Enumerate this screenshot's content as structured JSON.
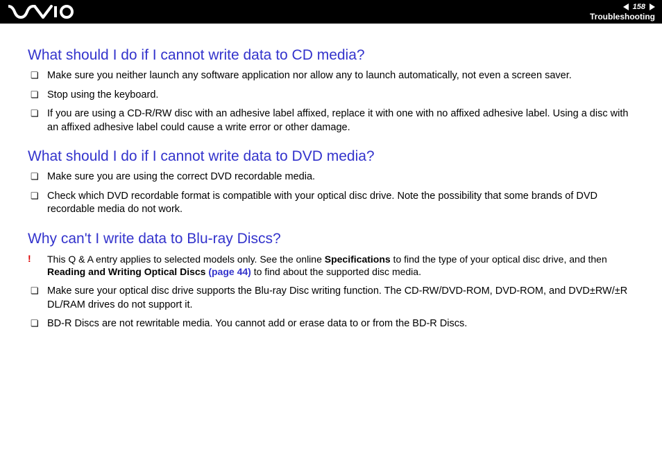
{
  "header": {
    "page_number": "158",
    "section": "Troubleshooting"
  },
  "sections": [
    {
      "heading": "What should I do if I cannot write data to CD media?",
      "bullets": [
        "Make sure you neither launch any software application nor allow any to launch automatically, not even a screen saver.",
        "Stop using the keyboard.",
        "If you are using a CD-R/RW disc with an adhesive label affixed, replace it with one with no affixed adhesive label. Using a disc with an affixed adhesive label could cause a write error or other damage."
      ]
    },
    {
      "heading": "What should I do if I cannot write data to DVD media?",
      "bullets": [
        "Make sure you are using the correct DVD recordable media.",
        "Check which DVD recordable format is compatible with your optical disc drive. Note the possibility that some brands of DVD recordable media do not work."
      ]
    },
    {
      "heading": "Why can't I write data to Blu-ray Discs?",
      "note": {
        "pre": "This Q & A entry applies to selected models only. See the online ",
        "bold1": "Specifications",
        "mid": " to find the type of your optical disc drive, and then ",
        "bold2": "Reading and Writing Optical Discs ",
        "link": "(page 44)",
        "post": " to find about the supported disc media."
      },
      "bullets": [
        "Make sure your optical disc drive supports the Blu-ray Disc writing function. The CD-RW/DVD-ROM, DVD-ROM, and DVD±RW/±R DL/RAM drives do not support it.",
        "BD-R Discs are not rewritable media. You cannot add or erase data to or from the BD-R Discs."
      ]
    }
  ]
}
